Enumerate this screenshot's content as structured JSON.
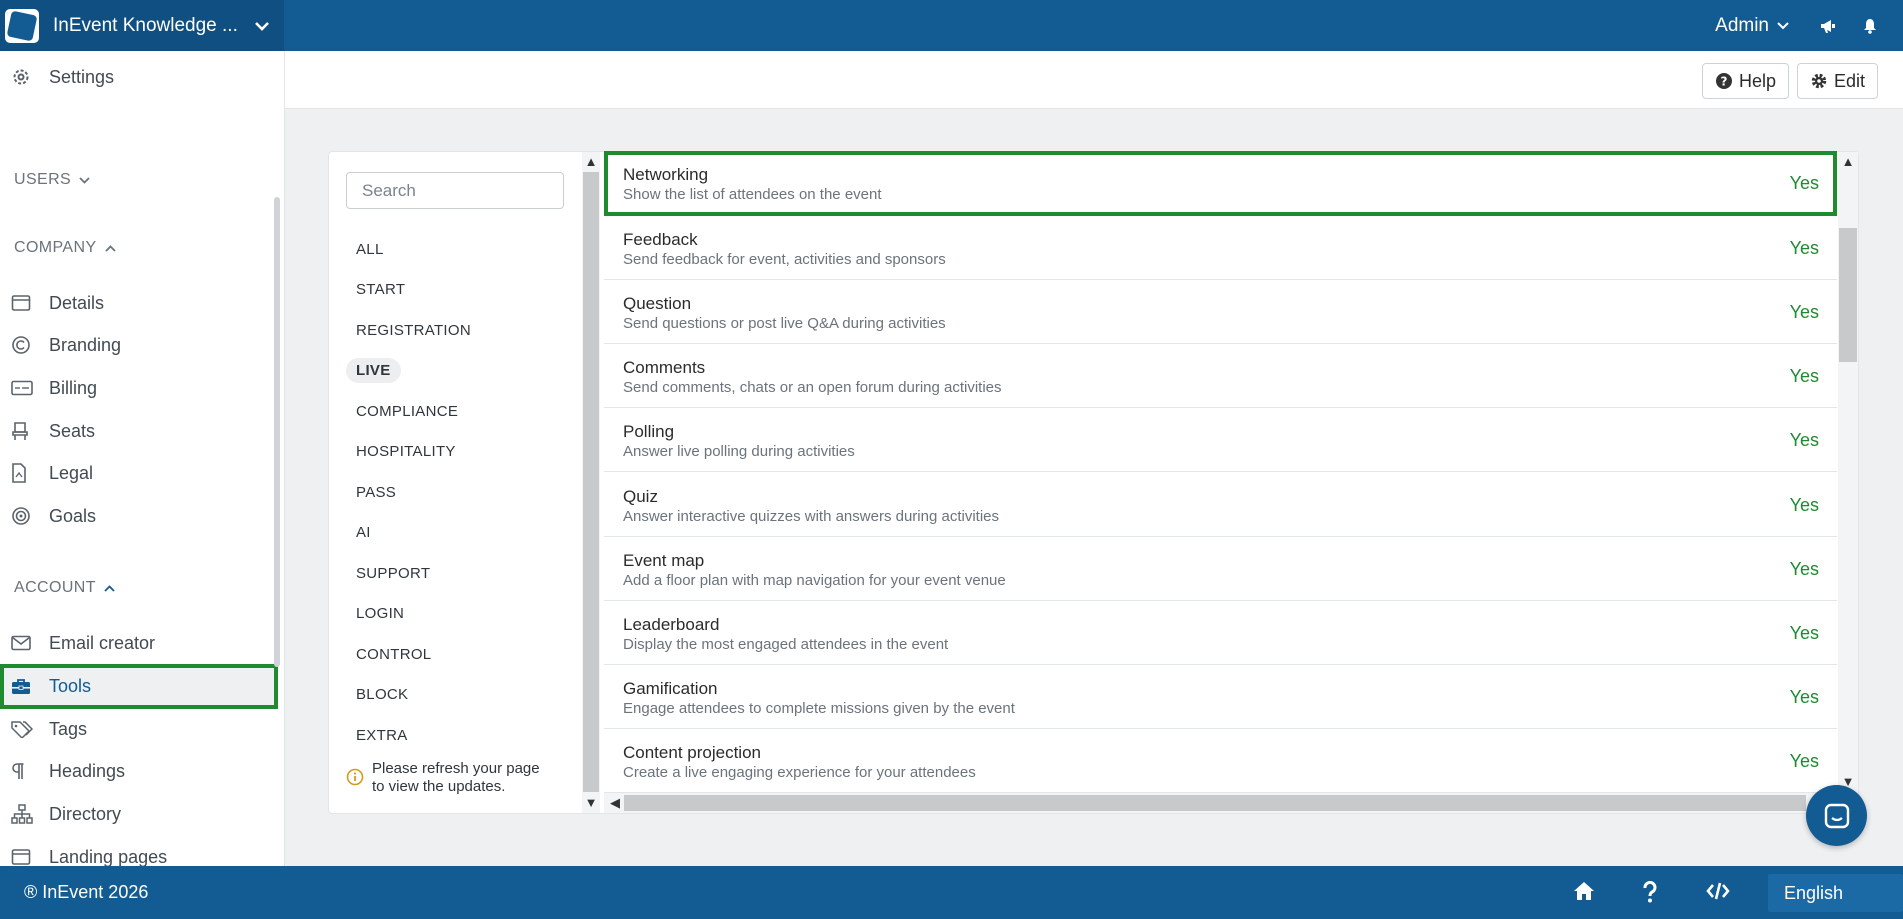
{
  "topbar": {
    "app_title": "InEvent Knowledge ...",
    "user_menu": "Admin"
  },
  "header": {
    "help_label": "Help",
    "edit_label": "Edit"
  },
  "sidebar": {
    "settings_label": "Settings",
    "users_heading": "USERS",
    "company_heading": "COMPANY",
    "account_heading": "ACCOUNT",
    "company_items": [
      {
        "label": "Details",
        "icon": "calendar-icon"
      },
      {
        "label": "Branding",
        "icon": "copyright-icon"
      },
      {
        "label": "Billing",
        "icon": "billing-card-icon"
      },
      {
        "label": "Seats",
        "icon": "seat-icon"
      },
      {
        "label": "Legal",
        "icon": "legal-document-icon"
      },
      {
        "label": "Goals",
        "icon": "target-icon"
      }
    ],
    "account_items": [
      {
        "label": "Email creator",
        "icon": "envelope-icon"
      },
      {
        "label": "Tools",
        "icon": "toolbox-icon",
        "active": true
      },
      {
        "label": "Tags",
        "icon": "tags-icon"
      },
      {
        "label": "Headings",
        "icon": "paragraph-icon"
      },
      {
        "label": "Directory",
        "icon": "sitemap-icon"
      },
      {
        "label": "Landing pages",
        "icon": "window-icon"
      }
    ]
  },
  "tools": {
    "search_placeholder": "Search",
    "categories": [
      "ALL",
      "START",
      "REGISTRATION",
      "LIVE",
      "COMPLIANCE",
      "HOSPITALITY",
      "PASS",
      "AI",
      "SUPPORT",
      "LOGIN",
      "CONTROL",
      "BLOCK",
      "EXTRA"
    ],
    "active_category": "LIVE",
    "notice": "Please refresh your page to view the updates.",
    "rows": [
      {
        "name": "Networking",
        "desc": "Show the list of attendees on the event",
        "value": "Yes"
      },
      {
        "name": "Feedback",
        "desc": "Send feedback for event, activities and sponsors",
        "value": "Yes"
      },
      {
        "name": "Question",
        "desc": "Send questions or post live Q&A during activities",
        "value": "Yes"
      },
      {
        "name": "Comments",
        "desc": "Send comments, chats or an open forum during activities",
        "value": "Yes"
      },
      {
        "name": "Polling",
        "desc": "Answer live polling during activities",
        "value": "Yes"
      },
      {
        "name": "Quiz",
        "desc": "Answer interactive quizzes with answers during activities",
        "value": "Yes"
      },
      {
        "name": "Event map",
        "desc": "Add a floor plan with map navigation for your event venue",
        "value": "Yes"
      },
      {
        "name": "Leaderboard",
        "desc": "Display the most engaged attendees in the event",
        "value": "Yes"
      },
      {
        "name": "Gamification",
        "desc": "Engage attendees to complete missions given by the event",
        "value": "Yes"
      },
      {
        "name": "Content projection",
        "desc": "Create a live engaging experience for your attendees",
        "value": "Yes"
      }
    ]
  },
  "footer": {
    "copyright": "® InEvent 2026",
    "language": "English"
  },
  "colors": {
    "primary": "#125b93",
    "highlight": "#1f8a2e",
    "yes": "#1f8a2e"
  }
}
